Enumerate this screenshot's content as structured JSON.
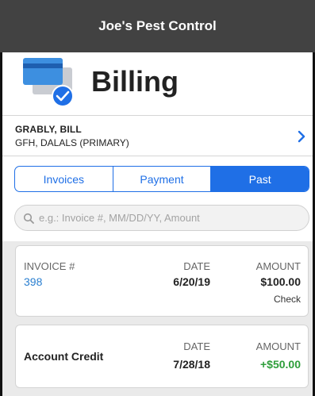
{
  "app": {
    "title": "Joe's Pest Control"
  },
  "hero": {
    "title": "Billing",
    "icon": "billing-card-check-icon"
  },
  "account": {
    "name": "GRABLY, BILL",
    "subtitle": "GFH, DALALS (PRIMARY)",
    "icon": "chevron-right-icon"
  },
  "tabs": [
    {
      "label": "Invoices",
      "active": false
    },
    {
      "label": "Payment",
      "active": false
    },
    {
      "label": "Past",
      "active": true
    }
  ],
  "search": {
    "placeholder": "e.g.: Invoice #, MM/DD/YY, Amount",
    "value": ""
  },
  "records": [
    {
      "invoice_label": "INVOICE #",
      "invoice_number": "398",
      "date_label": "DATE",
      "date": "6/20/19",
      "amount_label": "AMOUNT",
      "amount": "$100.00",
      "method": "Check"
    },
    {
      "title": "Account Credit",
      "date_label": "DATE",
      "date": "7/28/18",
      "amount_label": "AMOUNT",
      "amount": "+$50.00"
    }
  ],
  "colors": {
    "header_bg": "#424242",
    "accent": "#1f6fe6",
    "link": "#2a7fd0",
    "credit": "#2e9e3a"
  }
}
